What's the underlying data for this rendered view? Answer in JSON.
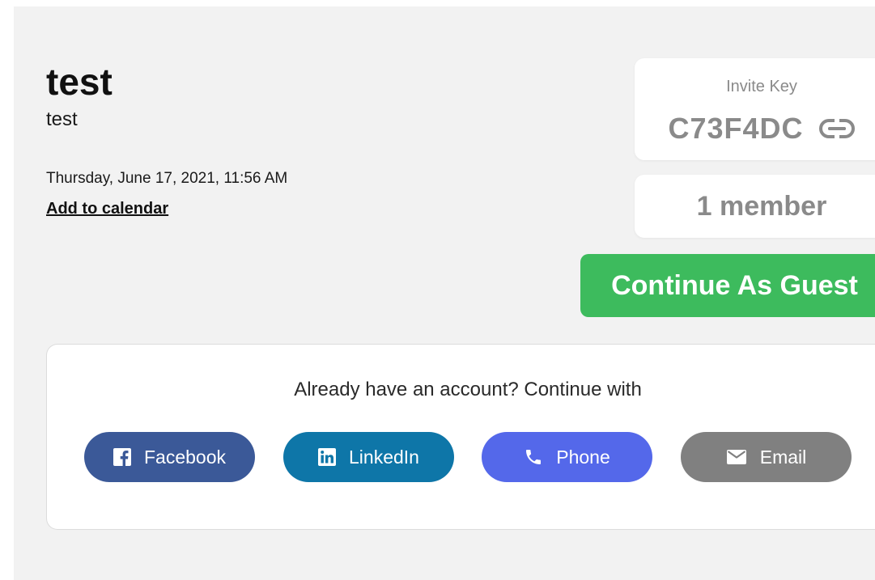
{
  "event": {
    "title": "test",
    "description": "test",
    "datetime": "Thursday, June 17, 2021, 11:56 AM",
    "add_to_calendar": "Add to calendar"
  },
  "invite": {
    "label": "Invite Key",
    "key": "C73F4DC",
    "icon": "link-icon"
  },
  "members": {
    "count_text": "1 member"
  },
  "guest_button": {
    "label": "Continue As Guest",
    "color": "#3dbb5d"
  },
  "login": {
    "prompt": "Already have an account? Continue with",
    "providers": [
      {
        "label": "Facebook",
        "icon": "facebook-icon",
        "color": "#3b5998"
      },
      {
        "label": "LinkedIn",
        "icon": "linkedin-icon",
        "color": "#0e76a8"
      },
      {
        "label": "Phone",
        "icon": "phone-icon",
        "color": "#5468ea"
      },
      {
        "label": "Email",
        "icon": "envelope-icon",
        "color": "#808080"
      }
    ]
  }
}
